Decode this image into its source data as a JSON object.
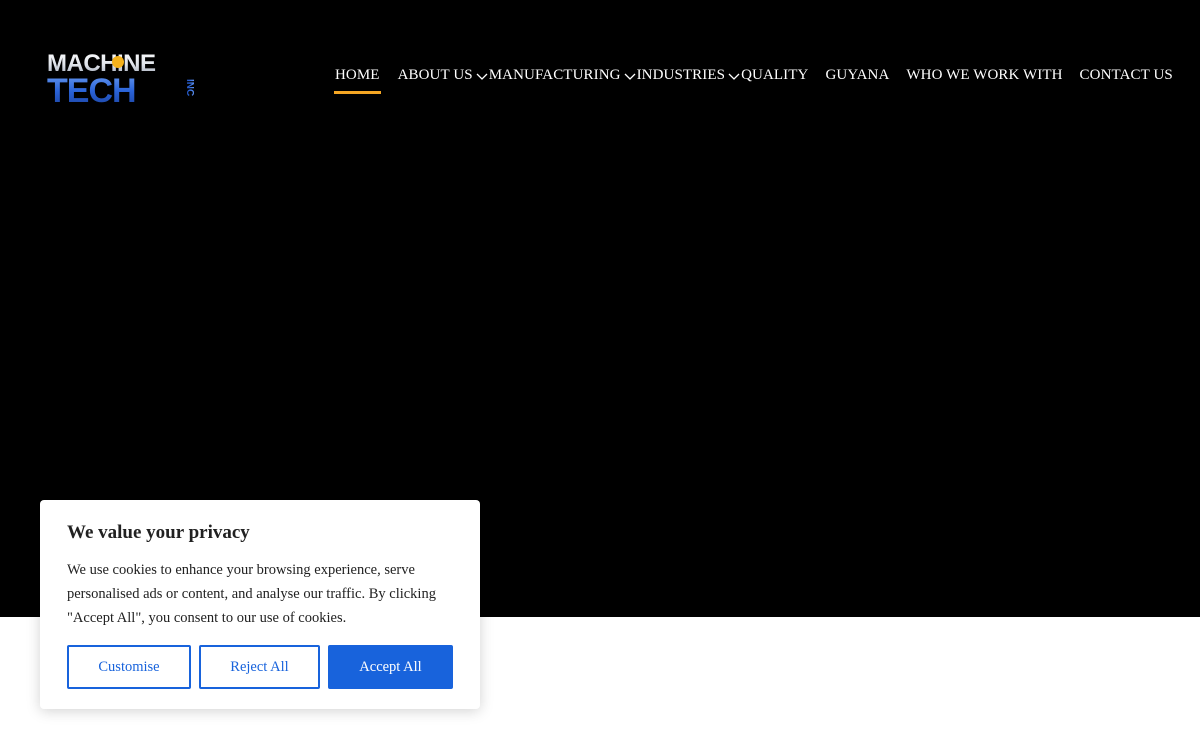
{
  "brand": {
    "line1": "MACHINE",
    "line2": "TECH",
    "suffix": "INC",
    "colors": {
      "silver": "#dfe3ea",
      "blue": "#2a63d8",
      "gold": "#f5b21b"
    }
  },
  "nav": {
    "items": [
      {
        "label": "HOME",
        "active": true,
        "dropdown": false
      },
      {
        "label": "ABOUT US",
        "active": false,
        "dropdown": true
      },
      {
        "label": "MANUFACTURING",
        "active": false,
        "dropdown": true
      },
      {
        "label": "INDUSTRIES",
        "active": false,
        "dropdown": true
      },
      {
        "label": "QUALITY",
        "active": false,
        "dropdown": false
      },
      {
        "label": "GUYANA",
        "active": false,
        "dropdown": false
      },
      {
        "label": "WHO WE WORK WITH",
        "active": false,
        "dropdown": false
      },
      {
        "label": "CONTACT US",
        "active": false,
        "dropdown": false
      }
    ],
    "active_underline_color": "#f5a623"
  },
  "cookie": {
    "title": "We value your privacy",
    "body": "We use cookies to enhance your browsing experience, serve personalised ads or content, and analyse our traffic. By clicking \"Accept All\", you consent to our use of cookies.",
    "customise_label": "Customise",
    "reject_label": "Reject All",
    "accept_label": "Accept All",
    "accent_color": "#1863dc"
  }
}
